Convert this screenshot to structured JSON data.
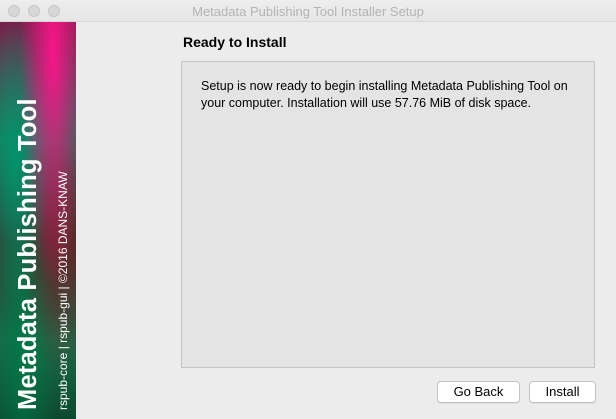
{
  "window": {
    "title": "Metadata Publishing Tool Installer Setup"
  },
  "banner": {
    "title": "Metadata Publishing Tool",
    "credit": "rspub-core | rspub-gui | ©2016 DANS-KNAW",
    "colors": [
      "#7a1f4a",
      "#ff148c",
      "#1e7a5e",
      "#3e2c2c",
      "#0c4a2e"
    ]
  },
  "page": {
    "heading": "Ready to Install",
    "message": "Setup is now ready to begin installing Metadata Publishing Tool on your computer. Installation will use 57.76 MiB of disk space."
  },
  "buttons": {
    "back_label": "Go Back",
    "install_label": "Install"
  }
}
